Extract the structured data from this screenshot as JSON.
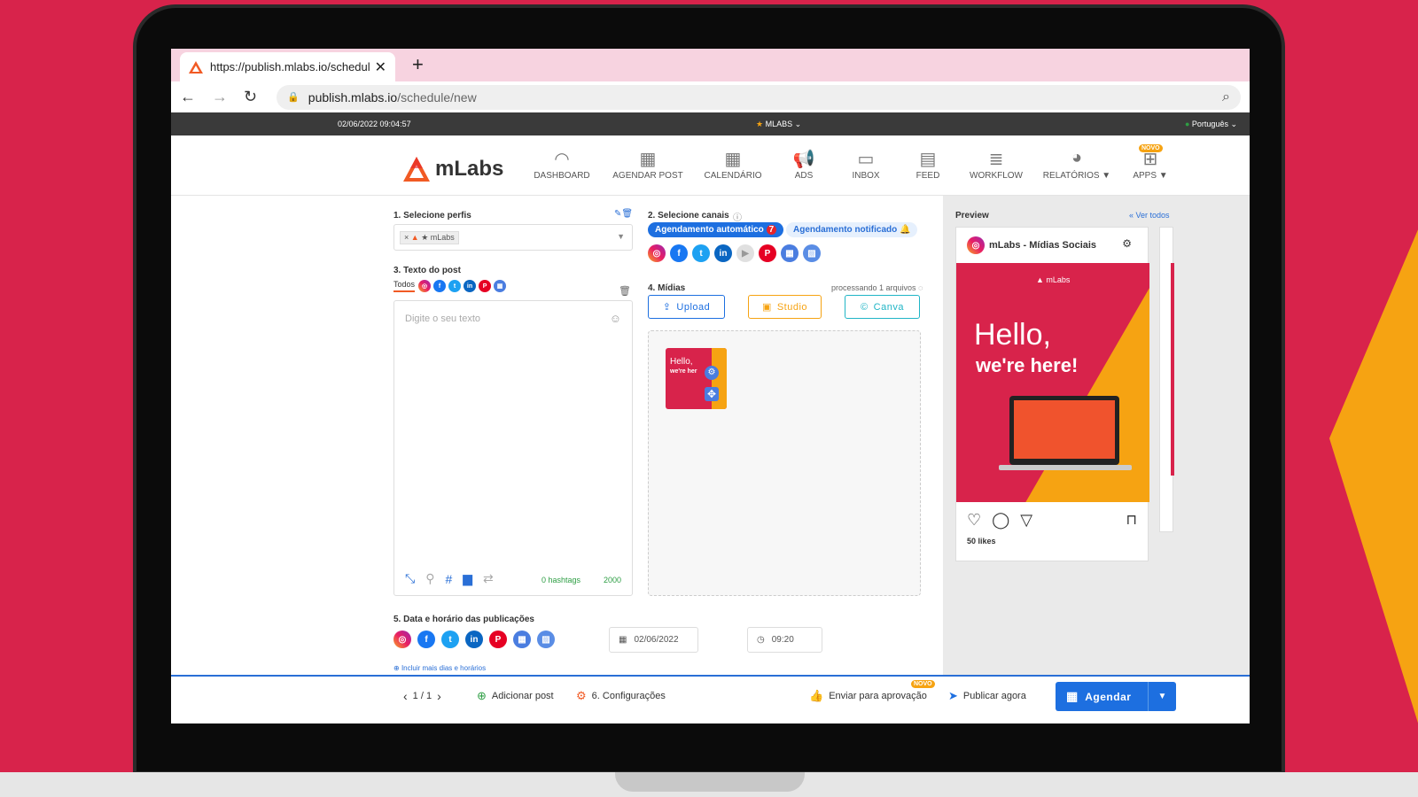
{
  "browser": {
    "tab_title": "https://publish.mlabs.io/schedule",
    "url_domain": "publish.mlabs.io",
    "url_path": "/schedule/new"
  },
  "topbar": {
    "datetime": "02/06/2022 09:04:57",
    "account": "MLABS",
    "language": "Português"
  },
  "brand": {
    "name": "mLabs",
    "accent": "#f15a24"
  },
  "nav": {
    "items": [
      {
        "label": "DASHBOARD",
        "icon": "gauge-icon"
      },
      {
        "label": "AGENDAR POST",
        "icon": "calendar-plus-icon"
      },
      {
        "label": "CALENDÁRIO",
        "icon": "calendar-icon"
      },
      {
        "label": "ADS",
        "icon": "megaphone-icon"
      },
      {
        "label": "INBOX",
        "icon": "inbox-icon"
      },
      {
        "label": "FEED",
        "icon": "feed-icon"
      },
      {
        "label": "WORKFLOW",
        "icon": "workflow-icon"
      },
      {
        "label": "RELATÓRIOS",
        "icon": "pie-chart-icon"
      },
      {
        "label": "APPS",
        "icon": "apps-icon"
      }
    ],
    "new_badge": "NOVO"
  },
  "step1": {
    "label": "1. Selecione perfis",
    "profile": "mLabs"
  },
  "step2": {
    "label": "2. Selecione canais",
    "auto": "Agendamento automático",
    "auto_count": "7",
    "notify": "Agendamento notificado"
  },
  "step3": {
    "label": "3. Texto do post",
    "all": "Todos",
    "placeholder": "Digite o seu texto",
    "hashtags": "0 hashtags",
    "chars": "2000"
  },
  "step4": {
    "label": "4. Mídias",
    "processing": "processando 1 arquivos",
    "upload": "Upload",
    "studio": "Studio",
    "canva": "Canva",
    "thumb_text1": "Hello,",
    "thumb_text2": "we're her"
  },
  "step5": {
    "label": "5. Data e horário das publicações",
    "date": "02/06/2022",
    "time": "09:20",
    "more": "Incluir mais dias e horários"
  },
  "preview": {
    "label": "Preview",
    "see_all": "Ver todos",
    "account": "mLabs - Mídias Sociais",
    "hello": "Hello,",
    "here": "we're here!",
    "likes": "50 likes"
  },
  "footer": {
    "pager": "1 / 1",
    "add_post": "Adicionar post",
    "settings": "6. Configurações",
    "approve": "Enviar para aprovação",
    "approve_badge": "NOVO",
    "publish": "Publicar agora",
    "schedule": "Agendar"
  }
}
